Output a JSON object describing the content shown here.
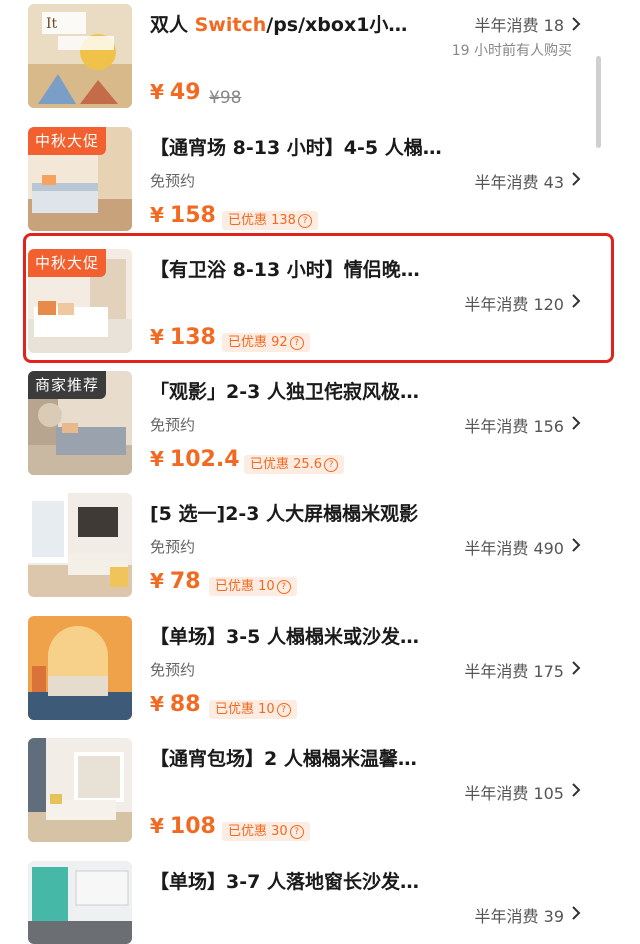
{
  "items": [
    {
      "title_prefix": "双人 ",
      "title_highlight": "Switch",
      "title_suffix": "/ps/xbox1小…",
      "sales": "半年消费 18",
      "recent": "19 小时前有人购买",
      "price": "49",
      "original_price": "¥98"
    },
    {
      "tag": "中秋大促",
      "title": "【通宵场 8-13 小时】4-5 人榻…",
      "sub": "免预约",
      "sales": "半年消费 43",
      "price": "158",
      "discount": "已优惠 138"
    },
    {
      "tag": "中秋大促",
      "title": "【有卫浴 8-13 小时】情侣晚…",
      "sales": "半年消费 120",
      "price": "138",
      "discount": "已优惠 92"
    },
    {
      "tag": "商家推荐",
      "title": "「观影」2-3 人独卫侘寂风极…",
      "sub": "免预约",
      "sales": "半年消费 156",
      "price": "102.4",
      "discount": "已优惠 25.6"
    },
    {
      "title": "[5 选一]2-3 人大屏榻榻米观影",
      "sub": "免预约",
      "sales": "半年消费 490",
      "price": "78",
      "discount": "已优惠 10"
    },
    {
      "title": "【单场】3-5 人榻榻米或沙发…",
      "sub": "免预约",
      "sales": "半年消费 175",
      "price": "88",
      "discount": "已优惠 10"
    },
    {
      "title": "【通宵包场】2 人榻榻米温馨…",
      "sales": "半年消费 105",
      "price": "108",
      "discount": "已优惠 30"
    },
    {
      "title": "【单场】3-7 人落地窗长沙发…",
      "sales": "半年消费 39"
    }
  ],
  "currency_symbol": "¥",
  "question_mark": "?",
  "colors": {
    "accent": "#f26a21",
    "promo_tag": "#f2602f",
    "recommend_tag": "#3b3b3b",
    "highlight_border": "#e0231c"
  },
  "icons": [
    "chevron-right-icon",
    "question-circle-icon"
  ]
}
